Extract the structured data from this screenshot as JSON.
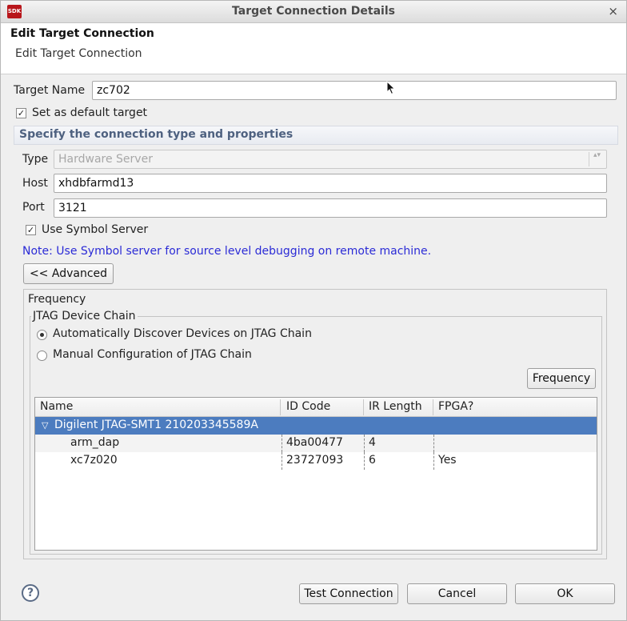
{
  "window": {
    "title": "Target Connection Details",
    "app_icon": "SDK",
    "close_glyph": "×"
  },
  "banner": {
    "title": "Edit Target Connection",
    "subtitle": "Edit Target Connection"
  },
  "form": {
    "target_name_label": "Target Name",
    "target_name_value": "zc702",
    "default_target_label": "Set as default target",
    "default_target_checked": true,
    "section_title": "Specify the connection type and properties",
    "type_label": "Type",
    "type_value": "Hardware Server",
    "host_label": "Host",
    "host_value": "xhdbfarmd13",
    "port_label": "Port",
    "port_value": "3121",
    "symbol_server_label": "Use Symbol Server",
    "symbol_server_checked": true,
    "note": "Note: Use Symbol server for source level debugging on remote machine.",
    "advanced_button": "<< Advanced"
  },
  "advanced": {
    "frequency_group": "Frequency",
    "jtag_group": "JTAG Device Chain",
    "auto_discover_label": "Automatically Discover Devices on JTAG Chain",
    "manual_config_label": "Manual Configuration of JTAG Chain",
    "frequency_button": "Frequency"
  },
  "table": {
    "columns": [
      "Name",
      "ID Code",
      "IR Length",
      "FPGA?"
    ],
    "rows": [
      {
        "name": "Digilent JTAG-SMT1 210203345589A",
        "id_code": "",
        "ir_length": "",
        "fpga": "",
        "expanded": true,
        "selected": true
      },
      {
        "name": "arm_dap",
        "id_code": "4ba00477",
        "ir_length": "4",
        "fpga": ""
      },
      {
        "name": "xc7z020",
        "id_code": "23727093",
        "ir_length": "6",
        "fpga": "Yes"
      }
    ]
  },
  "footer": {
    "help_glyph": "?",
    "test_connection": "Test Connection",
    "cancel": "Cancel",
    "ok": "OK"
  },
  "icons": {
    "check_glyph": "✓",
    "expand_glyph": "▽",
    "select_arrows": "▴▾"
  },
  "colors": {
    "selection": "#4c7cbf",
    "note_text": "#2b2bd6",
    "section_text": "#4e6180"
  }
}
